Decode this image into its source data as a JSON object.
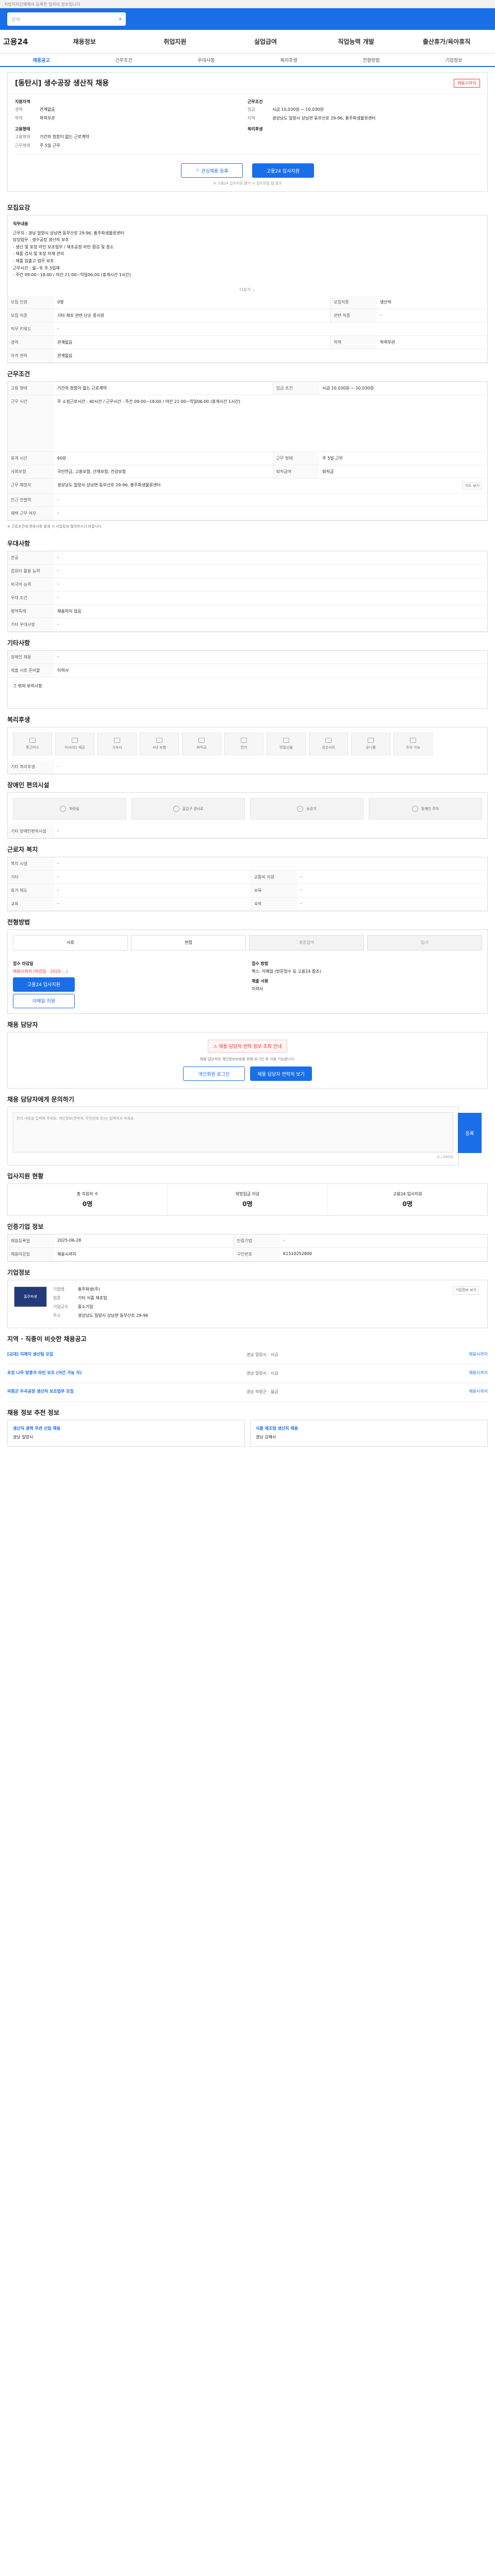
{
  "top_notice": "지방자치단체에서 등록한 일자리 정보입니다",
  "search_placeholder": "검색",
  "logo": "고용24",
  "gnb": [
    "채용정보",
    "취업지원",
    "실업급여",
    "직업능력 개발",
    "출산휴가/육아휴직"
  ],
  "tabs": [
    "채용공고",
    "근무조건",
    "우대사항",
    "복리후생",
    "전형방법",
    "기업정보"
  ],
  "job_title": "[동탄시] 생수공장 생산직 채용",
  "job_badge": "채용시까지",
  "summary": {
    "left_label": "지원자격",
    "left_rows": [
      {
        "k": "경력",
        "v": "관계없음"
      },
      {
        "k": "학력",
        "v": "학력무관"
      }
    ],
    "emp_label": "고용형태",
    "emp_rows": [
      {
        "k": "고용형태",
        "v": "기간의 정함이 없는 근로계약"
      },
      {
        "k": "근무형태",
        "v": "주 5일 근무"
      }
    ],
    "right_label": "근무조건",
    "right_rows": [
      {
        "k": "임금",
        "v": "시급 10,030원 ~ 10,030원"
      },
      {
        "k": "지역",
        "v": "경상남도 밀양시 상남면 동부산로 29-96, 홍주파생물류센터"
      }
    ],
    "welfare_label": "복리후생"
  },
  "cta": {
    "interest": "관심채용 등록",
    "apply": "고용24 입사지원",
    "note": "※ 고용24 입사지원 불가 시 접수방법 탭 참조"
  },
  "recruit": {
    "title": "모집요강",
    "duty_label": "직무내용",
    "duty_lines": [
      "근무지 : 경남 밀양시 상남면 동부산로 29-96, 홍주파생물류센터",
      "담당업무 : 생수공장 생산직 보조",
      "- 생산 및 포장 라인 보조업무 / 제조공정 라인 점검 및 청소",
      "- 제품 검사 및 포장 자재 관리",
      "- 제품 입출고 업무 보조",
      "근무시간 : 월~토 주 5일제",
      "- 주간 09:00~18:00 / 야간 21:00~익일06:00 (휴게시간 1시간)"
    ],
    "more_label": "더보기",
    "rows": [
      {
        "k": "모집 인원",
        "v": "0명",
        "k2": "모집직종",
        "v2": "생산직"
      },
      {
        "k": "모집 직종",
        "v": "기타 제조 관련 단순 종사원",
        "k2": "관련 직종",
        "v2": "-"
      },
      {
        "k": "직무 키워드",
        "v": "-",
        "k2": "",
        "v2": ""
      },
      {
        "k": "경력",
        "v": "관계없음",
        "k2": "학력",
        "v2": "학력무관"
      },
      {
        "k": "자격 면허",
        "v": "관계없음",
        "k2": "",
        "v2": ""
      }
    ]
  },
  "work": {
    "title": "근무조건",
    "rows": [
      {
        "k": "고용 형태",
        "v": "기간의 정함이 없는 근로계약",
        "k2": "임금 조건",
        "v2": "시급 10,030원 ~ 10,030원"
      },
      {
        "k": "근무 시간",
        "v": "주 소정근로시간 : 40시간 / 근무시간 : 주간 09:00~18:00 / 야간 21:00~익일06:00 (휴게시간 1시간)",
        "k2": "",
        "v2": ""
      },
      {
        "k": "휴게 시간",
        "v": "60분",
        "k2": "근무 형태",
        "v2": "주 5일 근무"
      },
      {
        "k": "사회보험",
        "v": "국민연금, 고용보험, 산재보험, 건강보험",
        "k2": "퇴직급여",
        "v2": "퇴직금"
      },
      {
        "k": "근무 예정지",
        "v": "경상남도 밀양시 상남면 동부산로 29-96, 홍주파생물류센터",
        "k2": "",
        "v2": ""
      },
      {
        "k": "인근 전철역",
        "v": "-",
        "k2": "",
        "v2": ""
      },
      {
        "k": "재택 근무 여부",
        "v": "-",
        "k2": "",
        "v2": ""
      }
    ],
    "map_label": "지도 보기",
    "note": "※ 근로조건에 변동사항 발생 시 사업장과 협의하시기 바랍니다."
  },
  "prefer": {
    "title": "우대사항",
    "rows": [
      {
        "k": "전공",
        "v": "-"
      },
      {
        "k": "컴퓨터 활용 능력",
        "v": "-"
      },
      {
        "k": "외국어 능력",
        "v": "-"
      },
      {
        "k": "우대 조건",
        "v": "-"
      },
      {
        "k": "병역특례",
        "v": "채용하지 않음"
      },
      {
        "k": "기타 우대사항",
        "v": "-"
      }
    ]
  },
  "etc": {
    "title": "기타사항",
    "rows": [
      {
        "k": "장애인 채용",
        "v": "-"
      },
      {
        "k": "제출 서류 준비물",
        "v": "이력서"
      }
    ],
    "extra": "그 밖의 유의사항"
  },
  "welfare": {
    "title": "복리후생",
    "tiles": [
      "통근버스",
      "식사(비) 제공",
      "기숙사",
      "4대 보험",
      "퇴직금",
      "연차",
      "명절선물",
      "경조사비",
      "유니폼",
      "주차 가능"
    ],
    "etc_label": "기타 복리후생",
    "etc_value": "-"
  },
  "disability": {
    "title": "장애인 편의시설",
    "tiles": [
      "화장실",
      "출입구 경사로",
      "승강기",
      "장애인 주차"
    ],
    "etc_label": "기타 장애인편의시설",
    "etc_value": "-"
  },
  "worker": {
    "title": "근로자 복지",
    "rows": [
      {
        "k": "복지 시설",
        "v": "-"
      },
      {
        "k": "기타",
        "v": "-",
        "k2": "교통비 지원",
        "v2": "-"
      },
      {
        "k": "휴가 제도",
        "v": "-",
        "k2": "보육",
        "v2": "-"
      },
      {
        "k": "교육",
        "v": "-",
        "k2": "숙박",
        "v2": "-"
      }
    ]
  },
  "selection": {
    "title": "전형방법",
    "steps": [
      "서류",
      "면접",
      "최종합격",
      "입사"
    ],
    "apply_label": "접수 마감일",
    "apply_value": "채용시까지 (마감일 : 2025-...)",
    "apply_btn": "고용24 입사지원",
    "apply_btn2": "이메일 지원",
    "method_label": "접수 방법",
    "method_value": "팩스, 이메일 (방문접수 등 고용24 참조)",
    "docs_label": "제출 서류",
    "docs_value": "이력서"
  },
  "contact": {
    "title": "채용 담당자",
    "warn": "채용 담당자 연락 정보 조회 안내",
    "desc": "채용 담당자의 개인정보보호를 위해 로그인 후 이용 가능합니다.",
    "btn1": "개인회원 로그인",
    "btn2": "채용 담당자 연락처 보기"
  },
  "qa": {
    "title": "채용 담당자에게 문의하기",
    "placeholder": "문의 내용을 입력해 주세요. 개인정보(연락처, 주민번호 등)는 입력하지 마세요.",
    "submit": "등록",
    "count": "0 / 500자"
  },
  "stats": {
    "title": "입사지원 현황",
    "items": [
      {
        "label": "총 지원자 수",
        "value": "0명"
      },
      {
        "label": "희망임금 이상",
        "value": "0명"
      },
      {
        "label": "고용24 입사지원",
        "value": "0명"
      }
    ]
  },
  "info": {
    "title": "인증기업 정보",
    "rows": [
      {
        "k": "채용등록일",
        "v": "2025-06-28",
        "k2": "인증기업",
        "v2": "-"
      },
      {
        "k": "채용마감일",
        "v": "채용시까지",
        "k2": "구인번호",
        "v2": "K1510252800"
      }
    ]
  },
  "company": {
    "title": "기업정보",
    "logo_text": "홍주파생",
    "rows": [
      {
        "k": "기업명",
        "v": "홍주파생(주)"
      },
      {
        "k": "업종",
        "v": "기타 식품 제조업"
      },
      {
        "k": "기업규모",
        "v": "중소기업"
      },
      {
        "k": "주소",
        "v": "경상남도 밀양시 상남면 동부산로 29-96"
      }
    ],
    "btn": "기업정보 보기"
  },
  "related": {
    "title": "지역 · 직종이 비슷한 채용공고",
    "items": [
      {
        "title": "[교대] 직제자 생산팀 모집",
        "meta": "경남 밀양시 · 시급",
        "tag": "채용시까지"
      },
      {
        "title": "포장 나무 방풍자 라인 보조 (야간 가능 자)",
        "meta": "경남 밀양시 · 시급",
        "tag": "채용시까지"
      },
      {
        "title": "의령군 두곡공장 생산직 보조업무 모집",
        "meta": "경남 의령군 · 월급",
        "tag": "채용시까지"
      }
    ]
  },
  "recommend": {
    "title": "채용 정보 추천 정보",
    "items": [
      {
        "title": "생산직 경력 무관 신입 채용",
        "meta": "경남 밀양시"
      },
      {
        "title": "식품 제조업 생산직 채용",
        "meta": "경남 김해시"
      }
    ]
  }
}
